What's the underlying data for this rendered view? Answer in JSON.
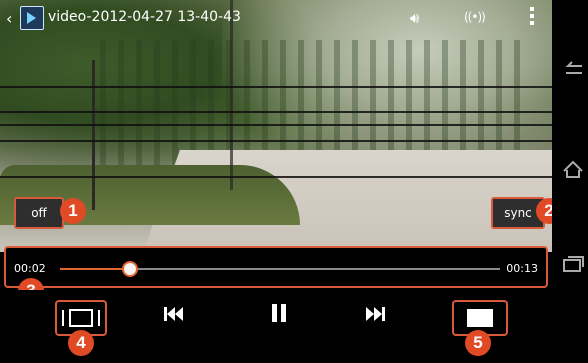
{
  "header": {
    "title": "video-2012-04-27 13-40-43",
    "icons": [
      "back-chevron",
      "video-app-icon",
      "volume-icon",
      "cast-icon",
      "overflow-menu-icon"
    ]
  },
  "overlay": {
    "subtitle_button_label": "off",
    "sync_button_label": "sync"
  },
  "playback": {
    "current_time": "00:02",
    "total_time": "00:13",
    "progress": 0.16
  },
  "controls": {
    "buttons": [
      "aspect-ratio",
      "previous",
      "pause",
      "next",
      "fullscreen"
    ]
  },
  "callouts": [
    "1",
    "2",
    "3",
    "4",
    "5"
  ],
  "colors": {
    "accent": "#e2642e",
    "callout": "#e04a25",
    "highlight_border": "#d9593b"
  }
}
